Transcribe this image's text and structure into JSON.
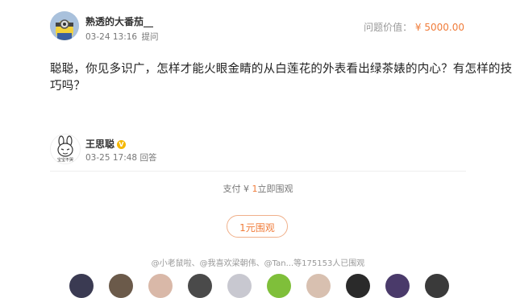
{
  "question": {
    "author": "熟透的大番茄__",
    "date": "03-24 13:16",
    "action": "提问",
    "price_label": "问题价值：",
    "price_value": "¥ 5000.00",
    "text": "聪聪，你见多识广，怎样才能火眼金睛的从白莲花的外表看出绿茶婊的内心？有怎样的技巧吗？"
  },
  "answer": {
    "author": "王思聪",
    "date": "03-25 17:48",
    "action": "回答",
    "avatar_caption": "宝宝不哭"
  },
  "pay": {
    "prefix": "支付 ¥ ",
    "amount": "1",
    "suffix": "立即围观"
  },
  "onlook_button": "1元围观",
  "viewers_text": "@小老鼠啦、@我喜欢梁朝伟、@Tan...等175153人已围观",
  "viewer_colors": [
    "#3a3a52",
    "#6b5a4a",
    "#d9b8a8",
    "#4a4a4a",
    "#c8c8d0",
    "#7fbf3a",
    "#d8c0b0",
    "#2a2a2a",
    "#4a3a6a",
    "#3a3a3a"
  ]
}
